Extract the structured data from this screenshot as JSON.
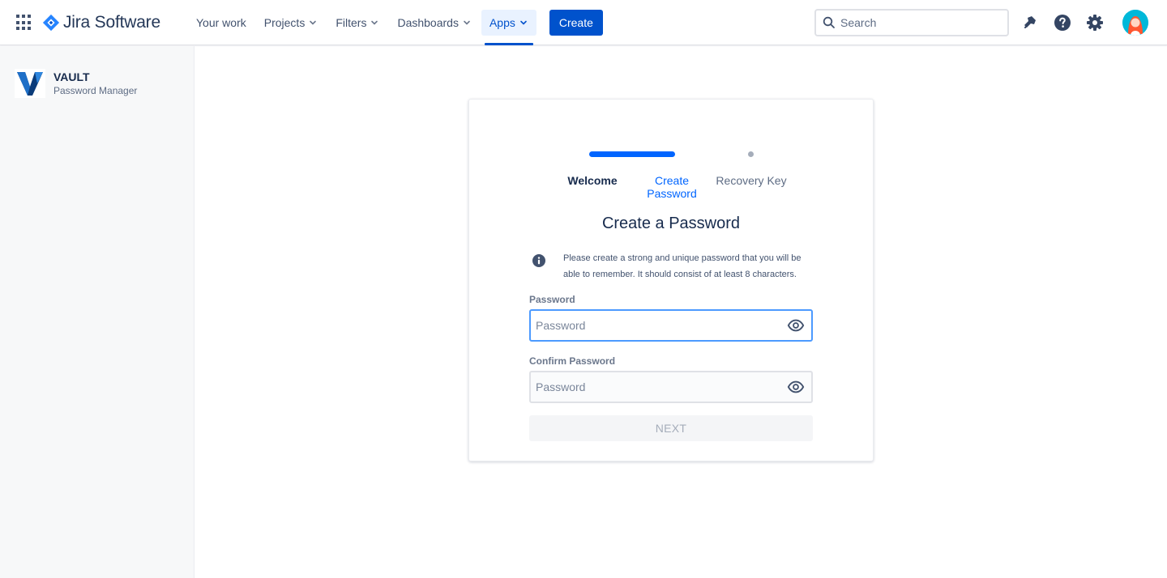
{
  "topnav": {
    "product_name": "Jira Software",
    "items": [
      {
        "label": "Your work",
        "has_chevron": false
      },
      {
        "label": "Projects",
        "has_chevron": true
      },
      {
        "label": "Filters",
        "has_chevron": true
      },
      {
        "label": "Dashboards",
        "has_chevron": true
      },
      {
        "label": "Apps",
        "has_chevron": true,
        "active": true
      }
    ],
    "create_label": "Create",
    "search_placeholder": "Search",
    "icons": [
      "app-switcher-icon",
      "jira-logo-icon",
      "notifications-icon",
      "help-icon",
      "settings-icon",
      "avatar"
    ],
    "accent_color": "#0052cc"
  },
  "sidebar": {
    "app_title": "VAULT",
    "app_subtitle": "Password Manager"
  },
  "wizard": {
    "steps": [
      {
        "label": "Welcome",
        "state": "complete"
      },
      {
        "label": "Create Password",
        "state": "current"
      },
      {
        "label": "Recovery Key",
        "state": "upcoming"
      }
    ],
    "title": "Create a Password",
    "info_text": "Please create a strong and unique password that you will be able to remember. It should consist of at least 8 characters.",
    "password_label": "Password",
    "password_placeholder": "Password",
    "confirm_label": "Confirm Password",
    "confirm_placeholder": "Password",
    "next_label": "NEXT",
    "next_enabled": false
  }
}
